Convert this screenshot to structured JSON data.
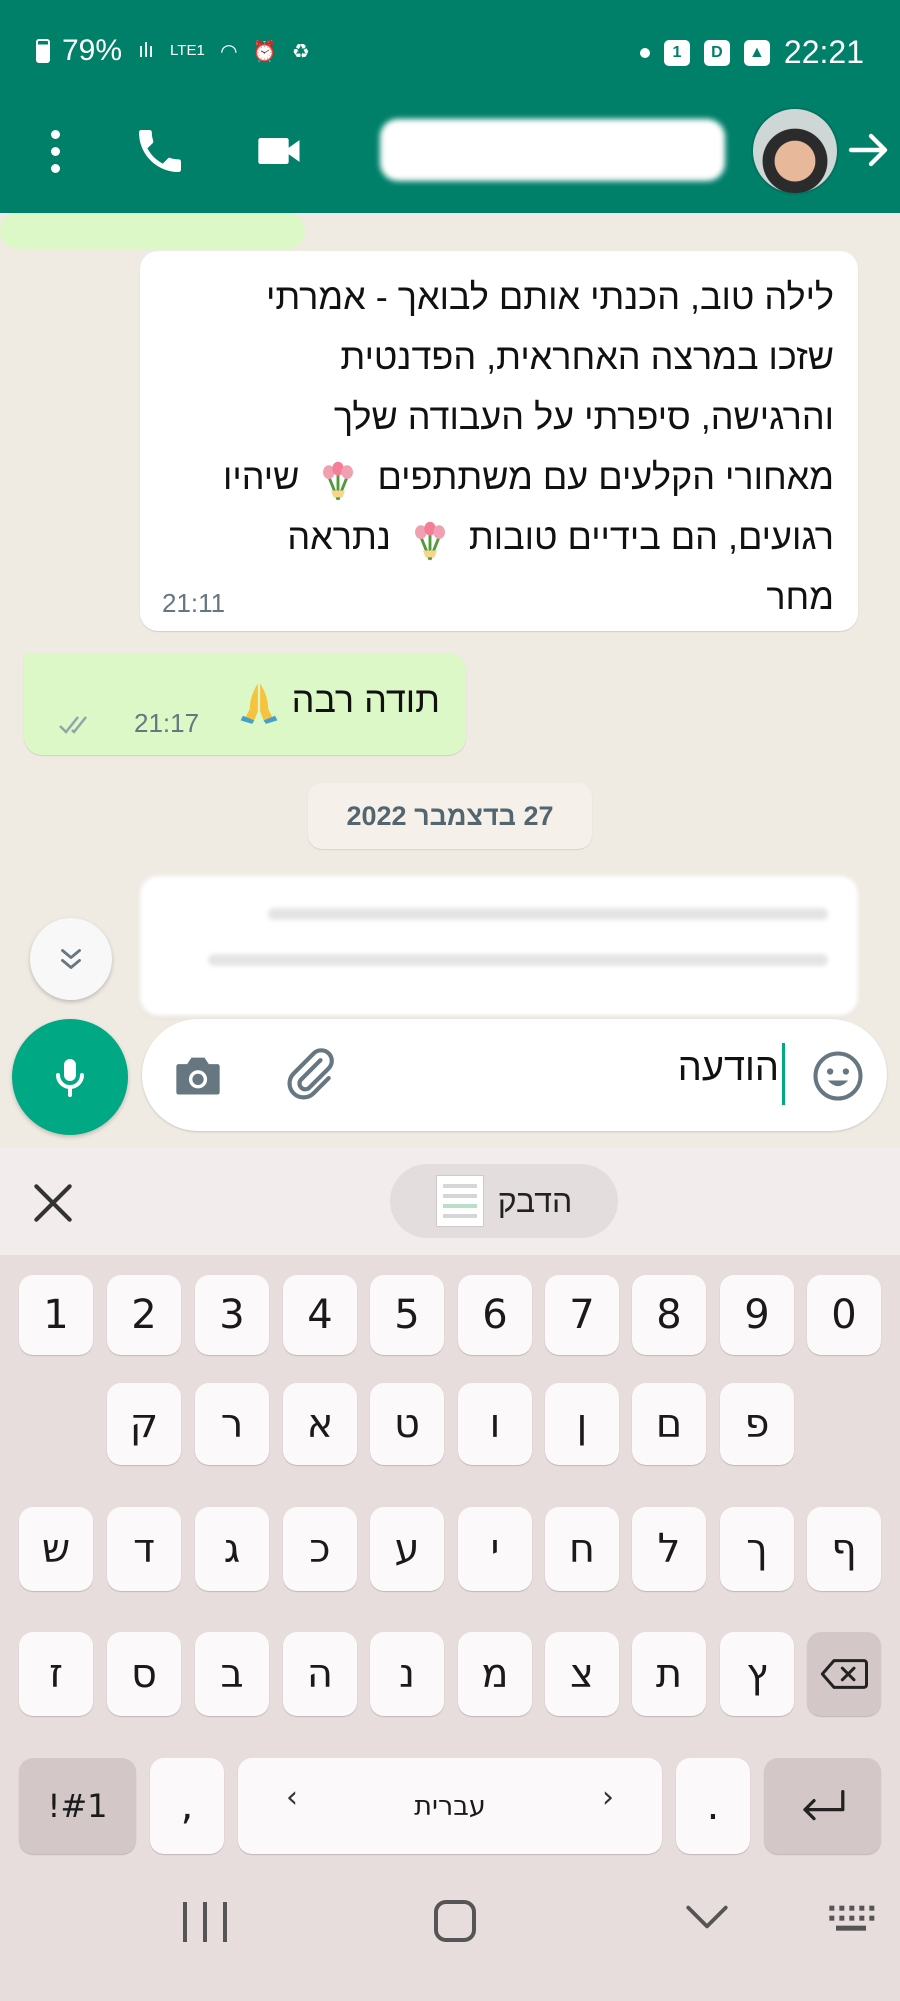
{
  "status_bar": {
    "battery": "79%",
    "network": "LTE1",
    "time": "22:21"
  },
  "chat": {
    "messages": [
      {
        "direction": "incoming",
        "lines": [
          "לילה טוב, הכנתי אותם לבואך - אמרתי",
          "שזכו במרצה האחראית, הפדנטית",
          "והרגישה, סיפרתי על העבודה שלך",
          "מאחורי הקלעים עם משתתפים",
          "שיהיו",
          "רגועים, הם בידיים טובות",
          "נתראה",
          "מחר"
        ],
        "time": "21:11"
      },
      {
        "direction": "outgoing",
        "text": "תודה רבה",
        "time": "21:17"
      }
    ],
    "date_divider": "27 בדצמבר 2022"
  },
  "composer": {
    "text": "הודעה"
  },
  "clipboard": {
    "paste_label": "הדבק"
  },
  "keyboard": {
    "row1": [
      "1",
      "2",
      "3",
      "4",
      "5",
      "6",
      "7",
      "8",
      "9",
      "0"
    ],
    "row2": [
      "ק",
      "ר",
      "א",
      "ט",
      "ו",
      "ן",
      "ם",
      "פ"
    ],
    "row3": [
      "ש",
      "ד",
      "ג",
      "כ",
      "ע",
      "י",
      "ח",
      "ל",
      "ך",
      "ף"
    ],
    "row4": [
      "ז",
      "ס",
      "ב",
      "ה",
      "נ",
      "מ",
      "צ",
      "ת",
      "ץ"
    ],
    "symbols_label": "!#1",
    "comma": ",",
    "language": "עברית",
    "period": "."
  },
  "colors": {
    "header": "#008069",
    "accent": "#00a884",
    "outgoing_bubble": "#dcf8c6",
    "incoming_bubble": "#ffffff"
  }
}
